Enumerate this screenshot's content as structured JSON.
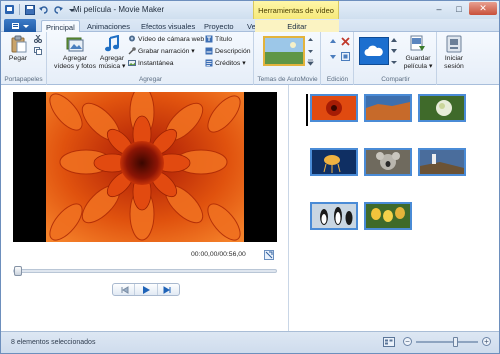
{
  "titlebar": {
    "title": "Mi película - Movie Maker",
    "contextual_group": "Herramientas de vídeo",
    "minimize_glyph": "–",
    "maximize_glyph": "□",
    "close_glyph": "✕"
  },
  "tabs": {
    "file_menu_icon": "file-menu-icon",
    "items": [
      "Principal",
      "Animaciones",
      "Efectos visuales",
      "Proyecto",
      "Ver",
      "Editar"
    ],
    "active": "Principal"
  },
  "ribbon": {
    "portapapeles": {
      "label": "Portapapeles",
      "paste": "Pegar"
    },
    "agregar": {
      "label": "Agregar",
      "add_videos_line1": "Agregar",
      "add_videos_line2": "vídeos y fotos",
      "add_music_line1": "Agregar",
      "add_music_line2": "música ▾",
      "webcam": "Vídeo de cámara web",
      "narration": "Grabar narración ▾",
      "snapshot": "Instantánea",
      "title": "Título",
      "caption": "Descripción",
      "credits": "Créditos ▾"
    },
    "automovie": {
      "label": "Temas de AutoMovie"
    },
    "edicion": {
      "label": "Edición"
    },
    "compartir": {
      "label": "Compartir",
      "save_line1": "Guardar",
      "save_line2": "película ▾"
    },
    "sesion": {
      "signin_line1": "Iniciar",
      "signin_line2": "sesión"
    }
  },
  "preview": {
    "time": "00:00,00/00:56,00",
    "seek_position": 0.0,
    "controls": [
      "previous-frame",
      "play",
      "next-frame"
    ]
  },
  "storyboard": {
    "clips": [
      {
        "name": "flower-red",
        "color": "#e04a10"
      },
      {
        "name": "desert",
        "color": "#c76a2a"
      },
      {
        "name": "hydrangea",
        "color": "#7aa84a"
      },
      {
        "name": "jellyfish",
        "color": "#1c4a8a"
      },
      {
        "name": "koala",
        "color": "#8c8c88"
      },
      {
        "name": "lighthouse",
        "color": "#6f8fb8"
      },
      {
        "name": "penguins",
        "color": "#b7c7d7"
      },
      {
        "name": "tulips",
        "color": "#e6b43a"
      }
    ]
  },
  "status": {
    "text": "8 elementos seleccionados",
    "zoom_level": 0.65
  },
  "colors": {
    "accent": "#1f5aa6",
    "contextual": "#f6e97a",
    "selection_border": "#4a8bd6"
  }
}
